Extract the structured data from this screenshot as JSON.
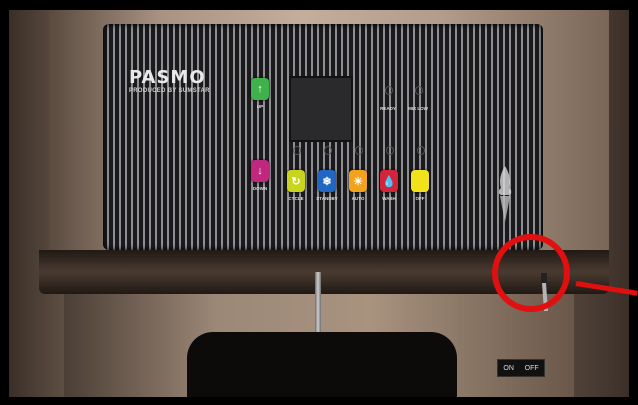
{
  "brand": {
    "name": "PASMO",
    "tagline": "PRODUCED BY SUMSTAR"
  },
  "buttons": {
    "up": {
      "label": "UP",
      "color": "#3fb24b",
      "icon": "up-arrow-icon"
    },
    "down": {
      "label": "DOWN",
      "color": "#c0287e",
      "icon": "down-arrow-icon"
    },
    "cycle": {
      "label": "CYCLE",
      "color": "#c8d41e",
      "icon": "cycle-icon"
    },
    "standby": {
      "label": "STANDBY",
      "color": "#2266c4",
      "icon": "standby-icon"
    },
    "auto": {
      "label": "AUTO",
      "color": "#f2a31c",
      "icon": "sun-icon"
    },
    "wash": {
      "label": "WASH",
      "color": "#d3243a",
      "icon": "water-drop-icon"
    },
    "off": {
      "label": "OFF",
      "color": "#f2e21c",
      "icon": "off-icon"
    }
  },
  "indicators": {
    "ready": "READY",
    "mix_low": "MIX LOW"
  },
  "switch": {
    "on": "ON",
    "off": "OFF"
  },
  "highlight_color": "#e01010"
}
